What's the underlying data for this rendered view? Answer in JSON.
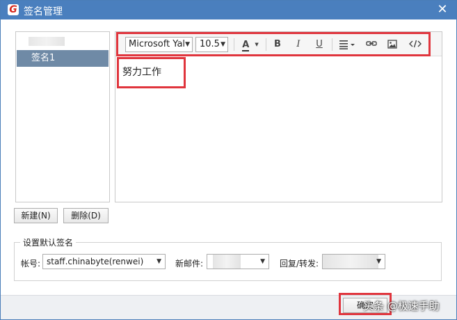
{
  "window": {
    "title": "签名管理",
    "app_icon": "G",
    "close_glyph": "✕"
  },
  "signatures": {
    "items": [
      {
        "label": "签名1",
        "selected": true
      }
    ]
  },
  "editor": {
    "font_family": "Microsoft Yal",
    "font_size": "10.5",
    "content": "努力工作",
    "toolbar_icons": [
      "font-color-icon",
      "bold-icon",
      "italic-icon",
      "underline-icon",
      "align-icon",
      "link-icon",
      "image-icon",
      "code-icon"
    ],
    "labels": {
      "font_color": "A",
      "bold": "B",
      "italic": "I",
      "underline": "U"
    }
  },
  "buttons": {
    "new": "新建(N)",
    "delete": "删除(D)",
    "ok": "确定"
  },
  "default_signature": {
    "legend": "设置默认签名",
    "account_label": "帐号:",
    "account_value": "staff.chinabyte(renwei)",
    "new_mail_label": "新邮件:",
    "reply_label": "回复/转发:"
  },
  "watermark": "头条 @极速手助",
  "colors": {
    "titlebar": "#4a7fbe",
    "selected_item": "#6f8aa6",
    "highlight": "#e0353d"
  }
}
